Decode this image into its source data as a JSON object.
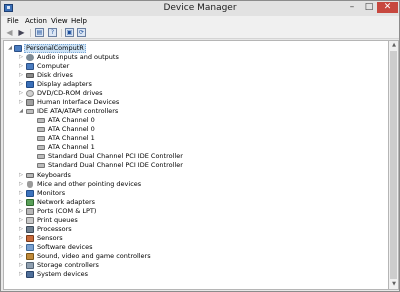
{
  "window": {
    "title": "Device Manager",
    "minimize": "–",
    "maximize": "□",
    "close": "✕"
  },
  "menu": {
    "file": "File",
    "action": "Action",
    "view": "View",
    "help": "Help"
  },
  "toolbar": {
    "back": "◀",
    "forward": "▶",
    "properties": "▤",
    "help": "?",
    "update": "▣",
    "scan": "⟳"
  },
  "tree": {
    "root": "PersonalComputR",
    "categories": [
      "Audio inputs and outputs",
      "Computer",
      "Disk drives",
      "Display adapters",
      "DVD/CD-ROM drives",
      "Human Interface Devices",
      "IDE ATA/ATAPI controllers"
    ],
    "ide_children": [
      "ATA Channel 0",
      "ATA Channel 0",
      "ATA Channel 1",
      "ATA Channel 1",
      "Standard Dual Channel PCI IDE Controller",
      "Standard Dual Channel PCI IDE Controller"
    ],
    "categories_after": [
      "Keyboards",
      "Mice and other pointing devices",
      "Monitors",
      "Network adapters",
      "Ports (COM & LPT)",
      "Print queues",
      "Processors",
      "Sensors",
      "Software devices",
      "Sound, video and game controllers",
      "Storage controllers",
      "System devices"
    ],
    "collapsed_glyph": "▷",
    "expanded_glyph": "◢"
  },
  "scrollbar": {
    "up": "▲",
    "down": "▼"
  }
}
